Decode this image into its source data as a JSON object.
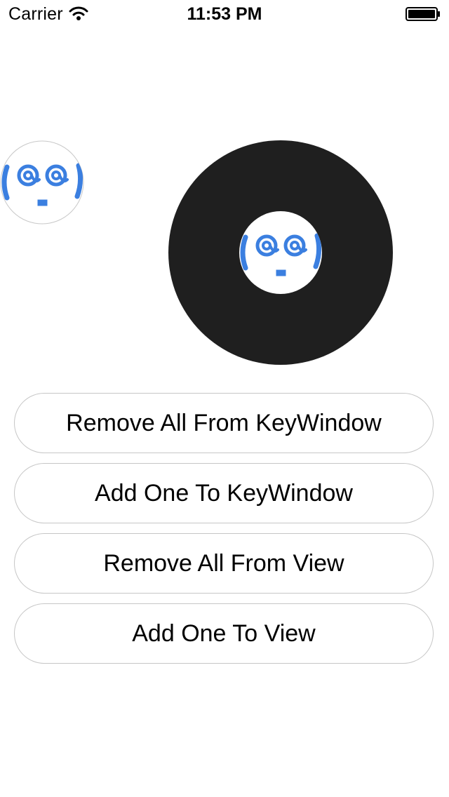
{
  "status_bar": {
    "carrier": "Carrier",
    "time": "11:53 PM",
    "wifi_icon": "wifi-icon",
    "battery_icon": "battery-icon"
  },
  "avatars": {
    "icon": "at-face-avatar-icon",
    "face_text": "(@@)",
    "accent_color": "#3b7fe0",
    "record_color": "#1f1f1f"
  },
  "buttons": [
    {
      "label": "Remove All From KeyWindow"
    },
    {
      "label": "Add One To KeyWindow"
    },
    {
      "label": "Remove All From View"
    },
    {
      "label": "Add One To View"
    }
  ]
}
